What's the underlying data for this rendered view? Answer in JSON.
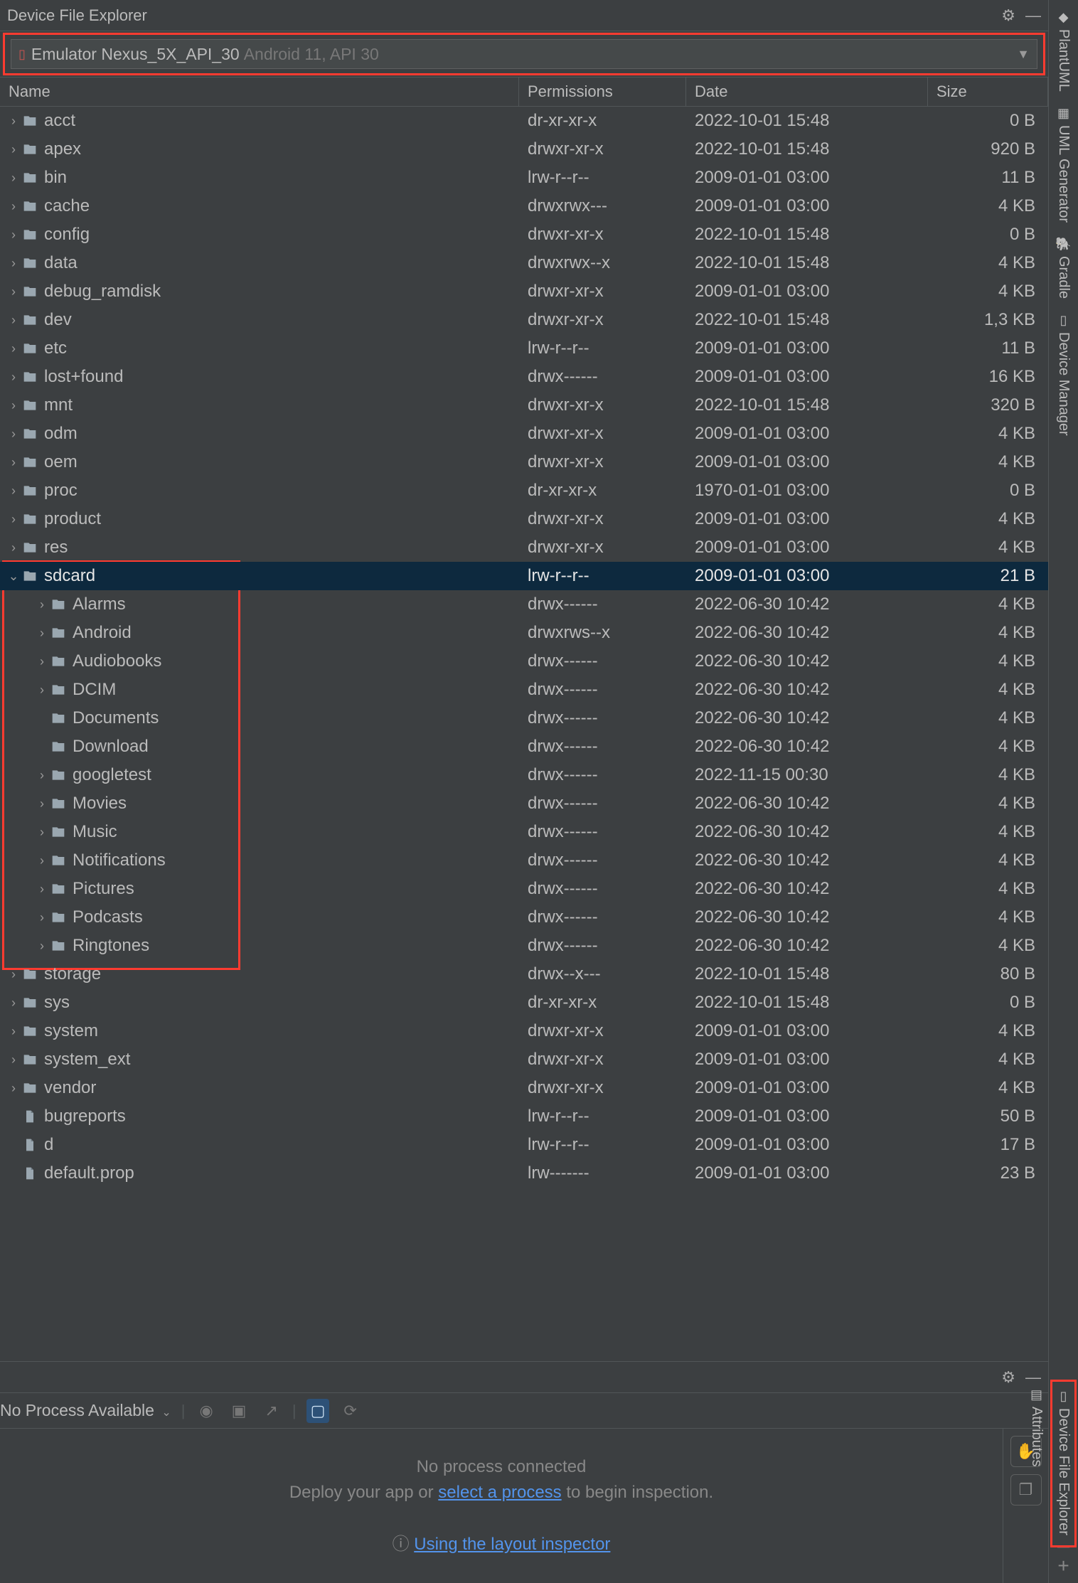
{
  "title": "Device File Explorer",
  "device": {
    "name": "Emulator Nexus_5X_API_30",
    "detail": "Android 11, API 30"
  },
  "columns": {
    "name": "Name",
    "perm": "Permissions",
    "date": "Date",
    "size": "Size"
  },
  "rows": [
    {
      "name": "acct",
      "perm": "dr-xr-xr-x",
      "date": "2022-10-01 15:48",
      "size": "0 B",
      "type": "dir",
      "expand": "closed",
      "indent": 0
    },
    {
      "name": "apex",
      "perm": "drwxr-xr-x",
      "date": "2022-10-01 15:48",
      "size": "920 B",
      "type": "dir",
      "expand": "closed",
      "indent": 0
    },
    {
      "name": "bin",
      "perm": "lrw-r--r--",
      "date": "2009-01-01 03:00",
      "size": "11 B",
      "type": "dir",
      "expand": "closed",
      "indent": 0
    },
    {
      "name": "cache",
      "perm": "drwxrwx---",
      "date": "2009-01-01 03:00",
      "size": "4 KB",
      "type": "dir",
      "expand": "closed",
      "indent": 0
    },
    {
      "name": "config",
      "perm": "drwxr-xr-x",
      "date": "2022-10-01 15:48",
      "size": "0 B",
      "type": "dir",
      "expand": "closed",
      "indent": 0
    },
    {
      "name": "data",
      "perm": "drwxrwx--x",
      "date": "2022-10-01 15:48",
      "size": "4 KB",
      "type": "dir",
      "expand": "closed",
      "indent": 0
    },
    {
      "name": "debug_ramdisk",
      "perm": "drwxr-xr-x",
      "date": "2009-01-01 03:00",
      "size": "4 KB",
      "type": "dir",
      "expand": "closed",
      "indent": 0
    },
    {
      "name": "dev",
      "perm": "drwxr-xr-x",
      "date": "2022-10-01 15:48",
      "size": "1,3 KB",
      "type": "dir",
      "expand": "closed",
      "indent": 0
    },
    {
      "name": "etc",
      "perm": "lrw-r--r--",
      "date": "2009-01-01 03:00",
      "size": "11 B",
      "type": "dir",
      "expand": "closed",
      "indent": 0
    },
    {
      "name": "lost+found",
      "perm": "drwx------",
      "date": "2009-01-01 03:00",
      "size": "16 KB",
      "type": "dir",
      "expand": "closed",
      "indent": 0
    },
    {
      "name": "mnt",
      "perm": "drwxr-xr-x",
      "date": "2022-10-01 15:48",
      "size": "320 B",
      "type": "dir",
      "expand": "closed",
      "indent": 0
    },
    {
      "name": "odm",
      "perm": "drwxr-xr-x",
      "date": "2009-01-01 03:00",
      "size": "4 KB",
      "type": "dir",
      "expand": "closed",
      "indent": 0
    },
    {
      "name": "oem",
      "perm": "drwxr-xr-x",
      "date": "2009-01-01 03:00",
      "size": "4 KB",
      "type": "dir",
      "expand": "closed",
      "indent": 0
    },
    {
      "name": "proc",
      "perm": "dr-xr-xr-x",
      "date": "1970-01-01 03:00",
      "size": "0 B",
      "type": "dir",
      "expand": "closed",
      "indent": 0
    },
    {
      "name": "product",
      "perm": "drwxr-xr-x",
      "date": "2009-01-01 03:00",
      "size": "4 KB",
      "type": "dir",
      "expand": "closed",
      "indent": 0
    },
    {
      "name": "res",
      "perm": "drwxr-xr-x",
      "date": "2009-01-01 03:00",
      "size": "4 KB",
      "type": "dir",
      "expand": "closed",
      "indent": 0
    },
    {
      "name": "sdcard",
      "perm": "lrw-r--r--",
      "date": "2009-01-01 03:00",
      "size": "21 B",
      "type": "dir",
      "expand": "open",
      "indent": 0,
      "selected": true
    },
    {
      "name": "Alarms",
      "perm": "drwx------",
      "date": "2022-06-30 10:42",
      "size": "4 KB",
      "type": "dir",
      "expand": "closed",
      "indent": 1
    },
    {
      "name": "Android",
      "perm": "drwxrws--x",
      "date": "2022-06-30 10:42",
      "size": "4 KB",
      "type": "dir",
      "expand": "closed",
      "indent": 1
    },
    {
      "name": "Audiobooks",
      "perm": "drwx------",
      "date": "2022-06-30 10:42",
      "size": "4 KB",
      "type": "dir",
      "expand": "closed",
      "indent": 1
    },
    {
      "name": "DCIM",
      "perm": "drwx------",
      "date": "2022-06-30 10:42",
      "size": "4 KB",
      "type": "dir",
      "expand": "closed",
      "indent": 1
    },
    {
      "name": "Documents",
      "perm": "drwx------",
      "date": "2022-06-30 10:42",
      "size": "4 KB",
      "type": "dir",
      "expand": "none",
      "indent": 1
    },
    {
      "name": "Download",
      "perm": "drwx------",
      "date": "2022-06-30 10:42",
      "size": "4 KB",
      "type": "dir",
      "expand": "none",
      "indent": 1
    },
    {
      "name": "googletest",
      "perm": "drwx------",
      "date": "2022-11-15 00:30",
      "size": "4 KB",
      "type": "dir",
      "expand": "closed",
      "indent": 1
    },
    {
      "name": "Movies",
      "perm": "drwx------",
      "date": "2022-06-30 10:42",
      "size": "4 KB",
      "type": "dir",
      "expand": "closed",
      "indent": 1
    },
    {
      "name": "Music",
      "perm": "drwx------",
      "date": "2022-06-30 10:42",
      "size": "4 KB",
      "type": "dir",
      "expand": "closed",
      "indent": 1
    },
    {
      "name": "Notifications",
      "perm": "drwx------",
      "date": "2022-06-30 10:42",
      "size": "4 KB",
      "type": "dir",
      "expand": "closed",
      "indent": 1
    },
    {
      "name": "Pictures",
      "perm": "drwx------",
      "date": "2022-06-30 10:42",
      "size": "4 KB",
      "type": "dir",
      "expand": "closed",
      "indent": 1
    },
    {
      "name": "Podcasts",
      "perm": "drwx------",
      "date": "2022-06-30 10:42",
      "size": "4 KB",
      "type": "dir",
      "expand": "closed",
      "indent": 1
    },
    {
      "name": "Ringtones",
      "perm": "drwx------",
      "date": "2022-06-30 10:42",
      "size": "4 KB",
      "type": "dir",
      "expand": "closed",
      "indent": 1
    },
    {
      "name": "storage",
      "perm": "drwx--x---",
      "date": "2022-10-01 15:48",
      "size": "80 B",
      "type": "dir",
      "expand": "closed",
      "indent": 0
    },
    {
      "name": "sys",
      "perm": "dr-xr-xr-x",
      "date": "2022-10-01 15:48",
      "size": "0 B",
      "type": "dir",
      "expand": "closed",
      "indent": 0
    },
    {
      "name": "system",
      "perm": "drwxr-xr-x",
      "date": "2009-01-01 03:00",
      "size": "4 KB",
      "type": "dir",
      "expand": "closed",
      "indent": 0
    },
    {
      "name": "system_ext",
      "perm": "drwxr-xr-x",
      "date": "2009-01-01 03:00",
      "size": "4 KB",
      "type": "dir",
      "expand": "closed",
      "indent": 0
    },
    {
      "name": "vendor",
      "perm": "drwxr-xr-x",
      "date": "2009-01-01 03:00",
      "size": "4 KB",
      "type": "dir",
      "expand": "closed",
      "indent": 0
    },
    {
      "name": "bugreports",
      "perm": "lrw-r--r--",
      "date": "2009-01-01 03:00",
      "size": "50 B",
      "type": "file",
      "expand": "none",
      "indent": 0
    },
    {
      "name": "d",
      "perm": "lrw-r--r--",
      "date": "2009-01-01 03:00",
      "size": "17 B",
      "type": "file",
      "expand": "none",
      "indent": 0
    },
    {
      "name": "default.prop",
      "perm": "lrw-------",
      "date": "2009-01-01 03:00",
      "size": "23 B",
      "type": "file",
      "expand": "none",
      "indent": 0
    }
  ],
  "bottom": {
    "process_label": "No Process Available",
    "msg1": "No process connected",
    "msg2a": "Deploy your app or ",
    "msg2_link": "select a process",
    "msg2b": " to begin inspection.",
    "help_link": "Using the layout inspector"
  },
  "side": {
    "plant": "PlantUML",
    "uml": "UML Generator",
    "gradle": "Gradle",
    "devmgr": "Device Manager",
    "attrs": "Attributes",
    "dfe": "Device File Explorer"
  }
}
